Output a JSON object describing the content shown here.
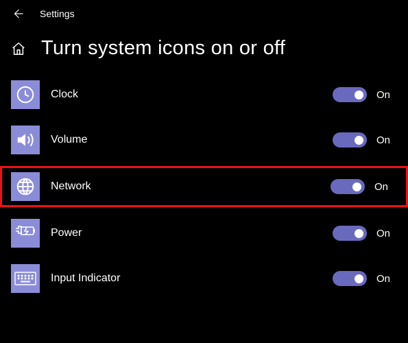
{
  "header": {
    "title": "Settings"
  },
  "page": {
    "title": "Turn system icons on or off"
  },
  "items": [
    {
      "id": "clock",
      "label": "Clock",
      "state": "On",
      "highlight": false
    },
    {
      "id": "volume",
      "label": "Volume",
      "state": "On",
      "highlight": false
    },
    {
      "id": "network",
      "label": "Network",
      "state": "On",
      "highlight": true
    },
    {
      "id": "power",
      "label": "Power",
      "state": "On",
      "highlight": false
    },
    {
      "id": "input",
      "label": "Input Indicator",
      "state": "On",
      "highlight": false
    }
  ],
  "colors": {
    "accent": "#8b8cd8",
    "toggle": "#6969be",
    "highlight": "#e11"
  }
}
